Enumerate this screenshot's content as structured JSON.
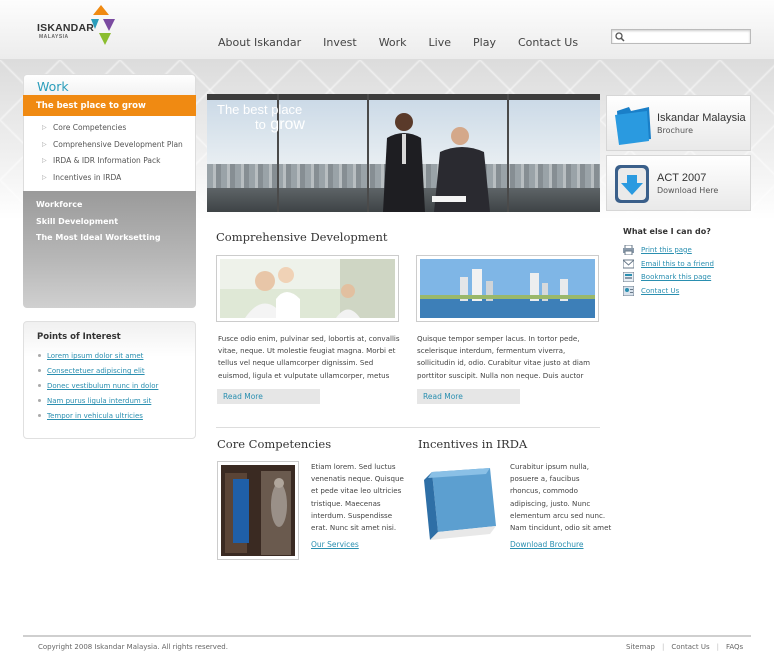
{
  "logo": {
    "name": "ISKANDAR",
    "sub": "MALAYSIA"
  },
  "nav": [
    "About Iskandar",
    "Invest",
    "Work",
    "Live",
    "Play",
    "Contact Us"
  ],
  "search": {
    "value": "",
    "icon": "search-icon"
  },
  "sidebar": {
    "title": "Work",
    "active": "The best place to grow",
    "sub_items": [
      "Core Competencies",
      "Comprehensive Development Plan",
      "IRDA & IDR Information Pack",
      "Incentives in IRDA"
    ],
    "items": [
      "Workforce",
      "Skill Development",
      "The Most Ideal Worksetting"
    ]
  },
  "points_of_interest": {
    "title": "Points of Interest",
    "links": [
      "Lorem ipsum dolor sit amet",
      "Consectetuer adipiscing elit",
      "Donec vestibulum nunc in dolor",
      "Nam purus ligula interdum sit",
      "Tempor in vehicula ultricies"
    ]
  },
  "hero": {
    "line1": "The best place",
    "line2_a": "to",
    "line2_b": "grow"
  },
  "promos": [
    {
      "title": "Iskandar Malaysia",
      "sub": "Brochure",
      "icon": "folder-icon"
    },
    {
      "title": "ACT 2007",
      "sub": "Download Here",
      "icon": "download-icon"
    }
  ],
  "what_else": {
    "title": "What else I can do?",
    "links": [
      {
        "label": "Print this page",
        "icon": "printer-icon"
      },
      {
        "label": "Email this to a friend",
        "icon": "email-icon"
      },
      {
        "label": "Bookmark this page",
        "icon": "bookmark-icon"
      },
      {
        "label": "Contact Us",
        "icon": "contact-icon"
      }
    ]
  },
  "comprehensive": {
    "title": "Comprehensive Development",
    "col1": "Fusce odio enim, pulvinar sed, lobortis at, convallis vitae, neque. Ut molestie feugiat magna. Morbi et tellus vel neque ullamcorper dignissim. Sed euismod, ligula et vulputate ullamcorper, metus",
    "col2": "Quisque tempor semper lacus. In tortor pede, scelerisque interdum, fermentum viverra, sollicitudin id, odio. Curabitur vitae justo at diam porttitor suscipit. Nulla non neque. Duis auctor",
    "read_more": "Read More"
  },
  "core": {
    "title": "Core Competencies",
    "text": "Etiam lorem. Sed luctus venenatis neque. Quisque et pede vitae leo ultricies tristique. Maecenas interdum. Suspendisse erat. Nunc sit amet nisi.",
    "link": "Our Services"
  },
  "incentives": {
    "title": "Incentives in IRDA",
    "text": "Curabitur ipsum nulla, posuere a, faucibus rhoncus, commodo adipiscing, justo. Nunc elementum arcu sed nunc. Nam tincidunt, odio sit amet",
    "link": "Download Brochure"
  },
  "footer": {
    "copyright": "Copyright 2008 Iskandar Malaysia. All rights reserved.",
    "links": [
      "Sitemap",
      "Contact Us",
      "FAQs"
    ]
  },
  "colors": {
    "accent": "#f08a12",
    "link": "#2a8fb0",
    "heading": "#2a9dbb"
  }
}
